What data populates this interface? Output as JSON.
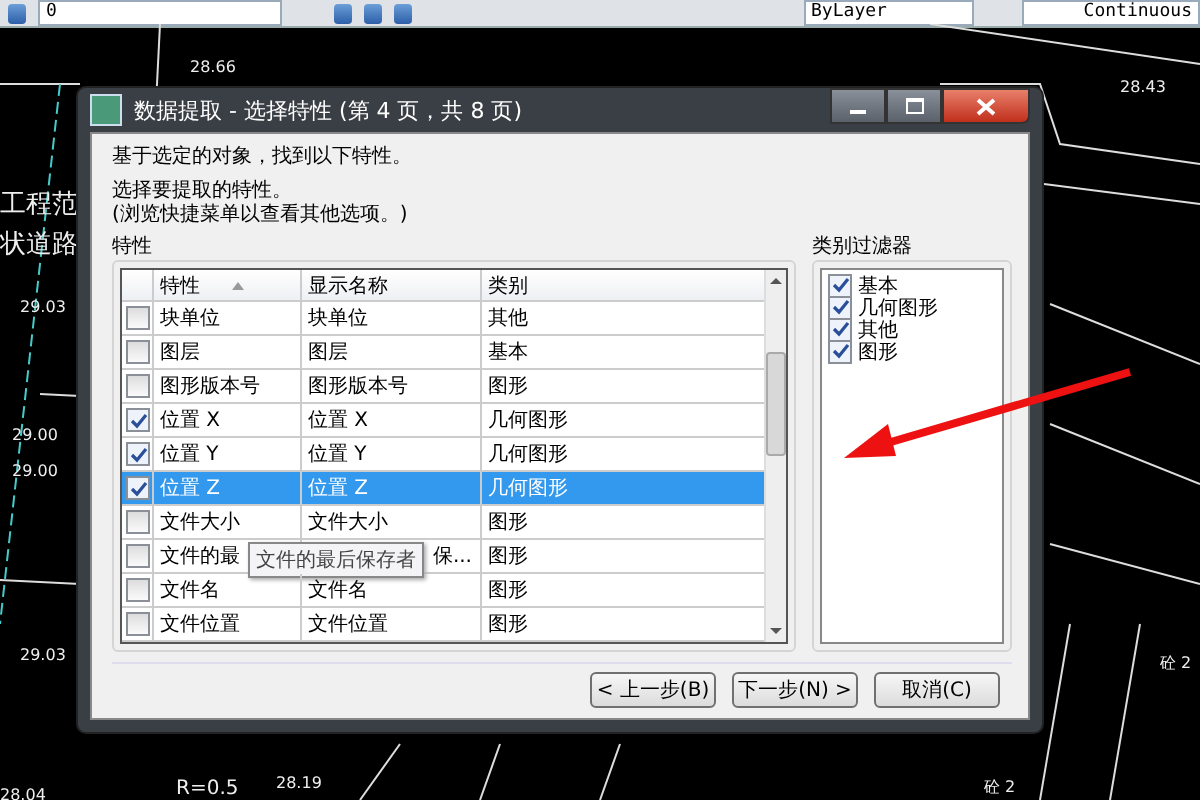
{
  "toolbar": {
    "layer": "0",
    "color_setting": "ByLayer",
    "linetype": "Continuous"
  },
  "cad_labels": [
    "工程范",
    "状道路",
    "29.03",
    "29.00",
    "29.00",
    "29.03",
    "28.04",
    "R=0.5",
    "28.66",
    "28.43",
    "28.19",
    "砼 2",
    "砼 2"
  ],
  "dialog": {
    "title": "数据提取 - 选择特性 (第 4 页，共 8 页)",
    "intro": "基于选定的对象，找到以下特性。",
    "instruction": "选择要提取的特性。",
    "hint": "(浏览快捷菜单以查看其他选项。)",
    "properties_label": "特性",
    "columns": [
      "特性",
      "显示名称",
      "类别"
    ],
    "rows": [
      {
        "property": "块单位",
        "display": "块单位",
        "category": "其他",
        "checked": false,
        "selected": false
      },
      {
        "property": "图层",
        "display": "图层",
        "category": "基本",
        "checked": false,
        "selected": false
      },
      {
        "property": "图形版本号",
        "display": "图形版本号",
        "category": "图形",
        "checked": false,
        "selected": false
      },
      {
        "property": "位置 X",
        "display": "位置 X",
        "category": "几何图形",
        "checked": true,
        "selected": false
      },
      {
        "property": "位置 Y",
        "display": "位置 Y",
        "category": "几何图形",
        "checked": true,
        "selected": false
      },
      {
        "property": "位置 Z",
        "display": "位置 Z",
        "category": "几何图形",
        "checked": true,
        "selected": true
      },
      {
        "property": "文件大小",
        "display": "文件大小",
        "category": "图形",
        "checked": false,
        "selected": false
      },
      {
        "property": "文件的最",
        "display": "保...",
        "category": "图形",
        "checked": false,
        "selected": false,
        "tooltip": "文件的最后保存者"
      },
      {
        "property": "文件名",
        "display": "文件名",
        "category": "图形",
        "checked": false,
        "selected": false
      },
      {
        "property": "文件位置",
        "display": "文件位置",
        "category": "图形",
        "checked": false,
        "selected": false
      }
    ],
    "filter_label": "类别过滤器",
    "filters": [
      {
        "label": "基本",
        "checked": true
      },
      {
        "label": "几何图形",
        "checked": true
      },
      {
        "label": "其他",
        "checked": true
      },
      {
        "label": "图形",
        "checked": true
      }
    ],
    "buttons": [
      "< 上一步(B)",
      "下一步(N) >",
      "取消(C)"
    ]
  }
}
